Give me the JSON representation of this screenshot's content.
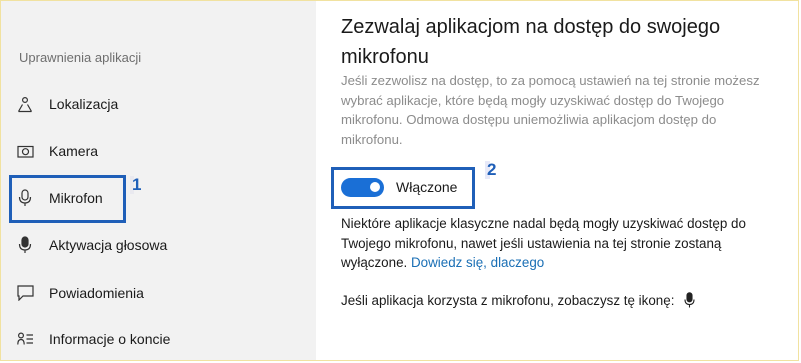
{
  "sidebar": {
    "heading": "Uprawnienia aplikacji",
    "items": [
      {
        "label": "Lokalizacja",
        "icon": "location-icon"
      },
      {
        "label": "Kamera",
        "icon": "camera-icon"
      },
      {
        "label": "Mikrofon",
        "icon": "microphone-icon",
        "selected": true
      },
      {
        "label": "Aktywacja głosowa",
        "icon": "voice-activation-icon"
      },
      {
        "label": "Powiadomienia",
        "icon": "notifications-icon"
      },
      {
        "label": "Informacje o koncie",
        "icon": "account-info-icon"
      }
    ]
  },
  "main": {
    "title": "Zezwalaj aplikacjom na dostęp do swojego mikrofonu",
    "description": "Jeśli zezwolisz na dostęp, to za pomocą ustawień na tej stronie możesz wybrać aplikacje, które będą mogły uzyskiwać dostęp do Twojego mikrofonu. Odmowa dostępu uniemożliwia aplikacjom dostęp do mikrofonu.",
    "toggle": {
      "state": "on",
      "label": "Włączone"
    },
    "note_text": "Niektóre aplikacje klasyczne nadal będą mogły uzyskiwać dostęp do Twojego mikrofonu, nawet jeśli ustawienia na tej stronie zostaną wyłączone.",
    "note_link": "Dowiedz się, dlaczego",
    "indicator_text": "Jeśli aplikacja korzysta z mikrofonu, zobaczysz tę ikonę:"
  },
  "annotations": [
    {
      "number": "1"
    },
    {
      "number": "2"
    }
  ],
  "colors": {
    "accent": "#1a6fd6",
    "annotation": "#1f5fb8",
    "link": "#1a6fb5",
    "sidebar_bg": "#f2f2f2"
  }
}
